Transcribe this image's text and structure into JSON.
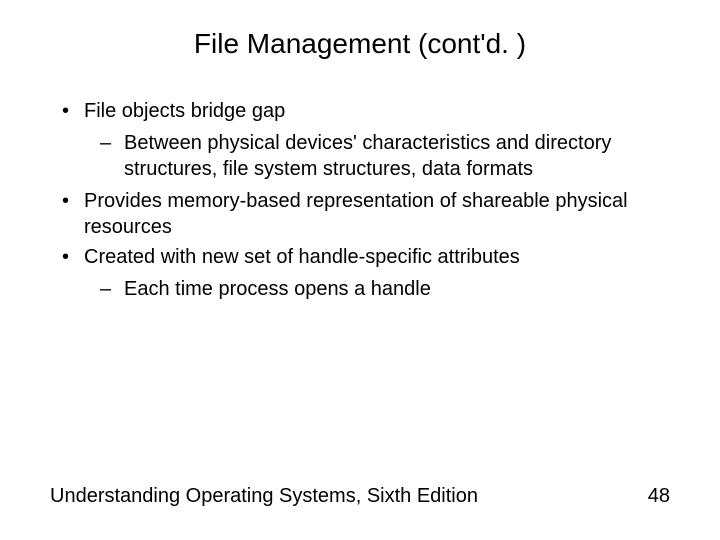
{
  "title": "File Management (cont'd. )",
  "bullets": {
    "b1": "File objects bridge gap",
    "b1_1": "Between physical devices' characteristics and directory structures, file system structures, data formats",
    "b2": "Provides memory-based representation of shareable physical resources",
    "b3": "Created with new set of handle-specific attributes",
    "b3_1": "Each time process opens a handle"
  },
  "footer": {
    "text": "Understanding Operating Systems, Sixth Edition",
    "page": "48"
  }
}
